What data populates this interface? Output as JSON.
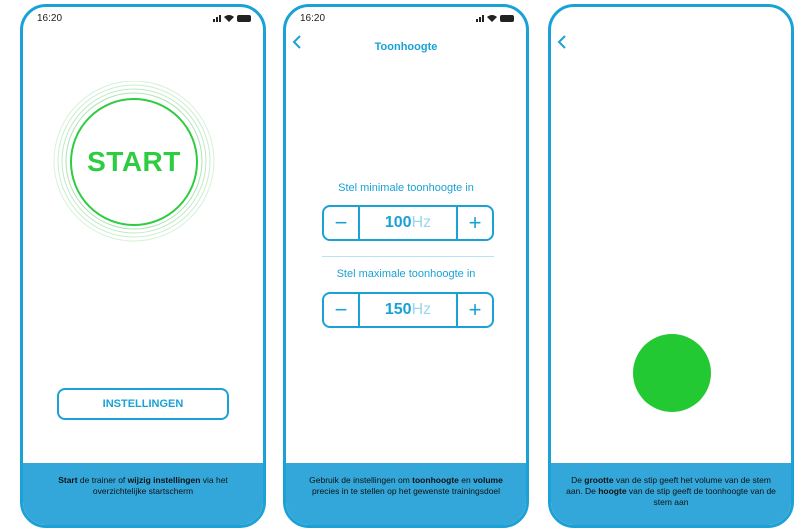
{
  "screen1": {
    "time": "16:20",
    "start_label": "START",
    "settings_label": "INSTELLINGEN",
    "footer": {
      "t1": "Start",
      "t2": " de trainer of ",
      "t3": "wijzig instellingen",
      "t4": " via het overzichtelijke startscherm"
    }
  },
  "screen2": {
    "time": "16:20",
    "title": "Toonhoogte",
    "min_label": "Stel minimale toonhoogte in",
    "min_value": "100",
    "max_label": "Stel maximale toonhoogte in",
    "max_value": "150",
    "unit": "Hz",
    "minus": "−",
    "plus": "+",
    "footer": {
      "t1": "Gebruik de instellingen om ",
      "t2": "toonhoogte",
      "t3": " en ",
      "t4": "volume",
      "t5": " precies in te stellen op het gewenste trainingsdoel"
    }
  },
  "screen3": {
    "footer": {
      "t1": "De ",
      "t2": "grootte",
      "t3": " van de stip geeft het volume van de stem aan. De ",
      "t4": "hoogte",
      "t5": " van de stip geeft de toonhoogte van de stem aan"
    }
  },
  "colors": {
    "accent": "#1aa2d6",
    "footer_bg": "#33a7d9",
    "start_green": "#2ecc40",
    "dot_green": "#22c933"
  },
  "icons": [
    "signal-icon",
    "wifi-icon",
    "battery-icon",
    "chevron-left-icon"
  ]
}
